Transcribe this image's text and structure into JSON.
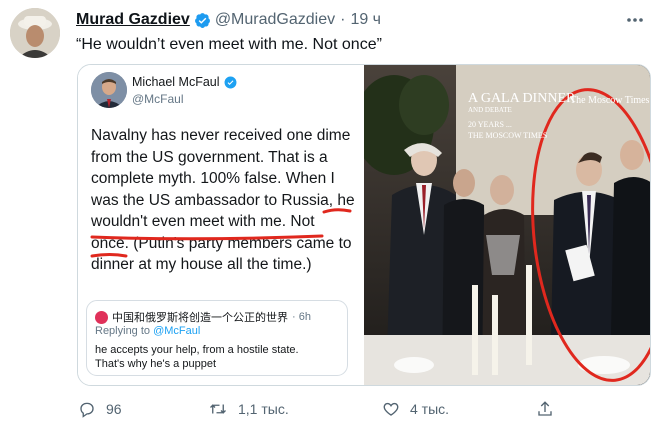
{
  "author": {
    "display_name": "Murad Gazdiev",
    "handle": "@MuradGazdiev",
    "separator": "·",
    "time": "19 ч",
    "verified": true
  },
  "tweet": {
    "text": "“He wouldn’t even meet with me. Not once”"
  },
  "embedded_tweet": {
    "name": "Michael McFaul",
    "handle": "@McFaul",
    "lines": [
      "Navalny has never received one dime",
      "from the US  government. That is a",
      "complete myth. 100% false. When I",
      "was the US ambassador to Russia, he",
      "wouldn't even meet with me.  Not",
      "once. (Putin's party members came to",
      "dinner at my house all the time.)"
    ],
    "quote": {
      "author": "中国和俄罗斯将创造一个公正的世界",
      "time": "· 6h",
      "replying_prefix": "Replying to ",
      "replying_handle": "@McFaul",
      "line1": "he accepts your help, from a hostile state.",
      "line2": "That's why he's a puppet"
    }
  },
  "photo": {
    "banner_line1": "A GALA DINNER",
    "banner_line2": "AND DEBATE",
    "banner_line3": "20 YEARS ...",
    "banner_line4": "THE MOSCOW TIMES",
    "banner_right": "The Moscow Times",
    "highlight_color": "#e0281e"
  },
  "actions": {
    "reply_count": "96",
    "retweet_count": "1,1 тыс.",
    "like_count": "4 тыс.",
    "icons": [
      "reply-icon",
      "retweet-icon",
      "like-icon",
      "share-icon"
    ]
  },
  "colors": {
    "accent": "#1d9bf0",
    "muted": "#536471",
    "annotation_red": "#e0281e"
  }
}
